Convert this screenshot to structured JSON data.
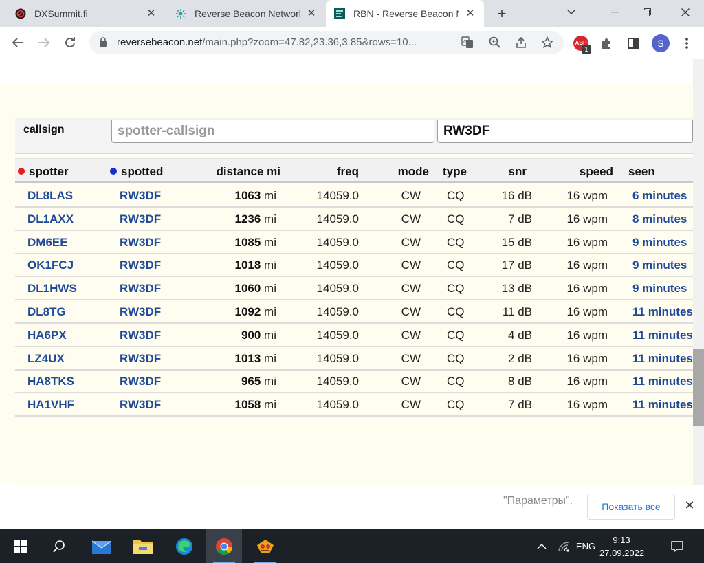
{
  "browser": {
    "tabs": [
      {
        "title": "DXSummit.fi",
        "icon": "dxsummit-icon",
        "active": false
      },
      {
        "title": "Reverse Beacon Network",
        "icon": "rbn-icon",
        "active": false
      },
      {
        "title": "RBN - Reverse Beacon Network",
        "icon": "rbn-list-icon",
        "active": true
      }
    ],
    "url_host": "reversebeacon.net",
    "url_path": "/main.php?zoom=47.82,23.36,3.85&rows=10...",
    "profile_initial": "S",
    "adblock_label": "ABP",
    "adblock_count": "1"
  },
  "filter": {
    "label": "callsign",
    "spotter_placeholder": "spotter-callsign",
    "spotted_value": "RW3DF"
  },
  "table": {
    "headers": {
      "spotter": "spotter",
      "spotted": "spotted",
      "distance": "distance mi",
      "freq": "freq",
      "mode": "mode",
      "type": "type",
      "snr": "snr",
      "speed": "speed",
      "seen": "seen"
    },
    "colors": {
      "spotter_dot": "#e02020",
      "spotted_dot": "#1530c8",
      "link": "#1f4a9a"
    },
    "rows": [
      {
        "spotter": "DL8LAS",
        "spotted": "RW3DF",
        "distance": "1063",
        "unit": "mi",
        "freq": "14059.0",
        "mode": "CW",
        "type": "CQ",
        "snr": "16 dB",
        "speed": "16 wpm",
        "seen": "6 minutes"
      },
      {
        "spotter": "DL1AXX",
        "spotted": "RW3DF",
        "distance": "1236",
        "unit": "mi",
        "freq": "14059.0",
        "mode": "CW",
        "type": "CQ",
        "snr": "7 dB",
        "speed": "16 wpm",
        "seen": "8 minutes"
      },
      {
        "spotter": "DM6EE",
        "spotted": "RW3DF",
        "distance": "1085",
        "unit": "mi",
        "freq": "14059.0",
        "mode": "CW",
        "type": "CQ",
        "snr": "15 dB",
        "speed": "16 wpm",
        "seen": "9 minutes"
      },
      {
        "spotter": "OK1FCJ",
        "spotted": "RW3DF",
        "distance": "1018",
        "unit": "mi",
        "freq": "14059.0",
        "mode": "CW",
        "type": "CQ",
        "snr": "17 dB",
        "speed": "16 wpm",
        "seen": "9 minutes"
      },
      {
        "spotter": "DL1HWS",
        "spotted": "RW3DF",
        "distance": "1060",
        "unit": "mi",
        "freq": "14059.0",
        "mode": "CW",
        "type": "CQ",
        "snr": "13 dB",
        "speed": "16 wpm",
        "seen": "9 minutes"
      },
      {
        "spotter": "DL8TG",
        "spotted": "RW3DF",
        "distance": "1092",
        "unit": "mi",
        "freq": "14059.0",
        "mode": "CW",
        "type": "CQ",
        "snr": "11 dB",
        "speed": "16 wpm",
        "seen": "11 minutes"
      },
      {
        "spotter": "HA6PX",
        "spotted": "RW3DF",
        "distance": "900",
        "unit": "mi",
        "freq": "14059.0",
        "mode": "CW",
        "type": "CQ",
        "snr": "4 dB",
        "speed": "16 wpm",
        "seen": "11 minutes"
      },
      {
        "spotter": "LZ4UX",
        "spotted": "RW3DF",
        "distance": "1013",
        "unit": "mi",
        "freq": "14059.0",
        "mode": "CW",
        "type": "CQ",
        "snr": "2 dB",
        "speed": "16 wpm",
        "seen": "11 minutes"
      },
      {
        "spotter": "HA8TKS",
        "spotted": "RW3DF",
        "distance": "965",
        "unit": "mi",
        "freq": "14059.0",
        "mode": "CW",
        "type": "CQ",
        "snr": "8 dB",
        "speed": "16 wpm",
        "seen": "11 minutes"
      },
      {
        "spotter": "HA1VHF",
        "spotted": "RW3DF",
        "distance": "1058",
        "unit": "mi",
        "freq": "14059.0",
        "mode": "CW",
        "type": "CQ",
        "snr": "7 dB",
        "speed": "16 wpm",
        "seen": "11 minutes"
      }
    ]
  },
  "notification": {
    "text": "\"Параметры\".",
    "show_all": "Показать все"
  },
  "taskbar": {
    "language": "ENG",
    "time": "9:13",
    "date": "27.09.2022"
  }
}
